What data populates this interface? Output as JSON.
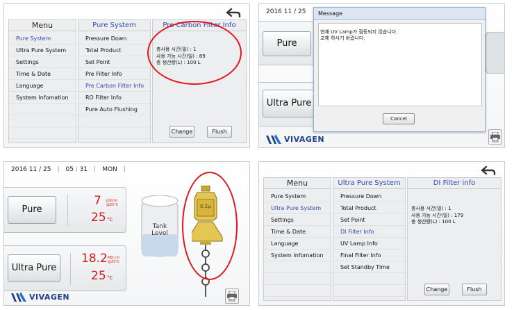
{
  "pure_settings": {
    "menu_header": "Menu",
    "menu_items": [
      "Pure System",
      "Ultra Pure System",
      "Settings",
      "Time & Date",
      "Language",
      "System Infomation"
    ],
    "sub_header": "Pure System",
    "sub_items": [
      "Pressure Down",
      "Total Product",
      "Set Point",
      "Pre Filter Info",
      "Pre Carbon Filter Info",
      "RO Filter Info",
      "Pure Auto Flushing"
    ],
    "info_header": "Pre Carbon Filter Info",
    "info_lines": [
      "총사용 시간(일) : 1",
      "사용 가능 시간(일) : 89",
      "총 생산량(L) : 100 L"
    ],
    "change_label": "Change",
    "flush_label": "Flush"
  },
  "message_screen": {
    "date": "2016 11 / 25",
    "dialog_title": "Message",
    "dialog_lines": [
      "현재 UV Lamp가 점등되지 않습니다.",
      "교체 하시기 바랍니다."
    ],
    "cancel_label": "Cancel",
    "pure_label": "Pure",
    "ultra_label": "Ultra Pure",
    "brand": "VIVAGEN",
    "print_label": "Print"
  },
  "home_screen": {
    "date": "2016 11 / 25",
    "time": "05 : 31",
    "day": "MON",
    "pure_label": "Pure",
    "pure_conductivity": "7",
    "pure_conductivity_unit": "μS/cm @25°C",
    "pure_temp": "25",
    "temp_unit": "°C",
    "ultra_label": "Ultra Pure",
    "ultra_resistivity": "18.2",
    "ultra_resistivity_unit": "MΩ.cm @25°C",
    "ultra_temp": "25",
    "tank_label_1": "Tank",
    "tank_label_2": "Level",
    "filter_label": "0.2μ",
    "brand": "VIVAGEN",
    "print_label": "Print"
  },
  "ultra_settings": {
    "menu_header": "Menu",
    "menu_items": [
      "Pure System",
      "Ultra Pure System",
      "Settings",
      "Time & Date",
      "Language",
      "System Infomation"
    ],
    "sub_header": "Ultra Pure System",
    "sub_items": [
      "Pressure Down",
      "Total Product",
      "Set Point",
      "DI Filter Info",
      "UV Lamp Info",
      "Final Filter Info",
      "Set Standby Time"
    ],
    "info_header": "DI Filter info",
    "info_lines": [
      "총사용 시간(일) : 1",
      "사용 가능 시간(일) : 179",
      "총 생산량(L) : 100 L"
    ],
    "change_label": "Change",
    "flush_label": "Flush"
  },
  "colors": {
    "accent_blue": "#3348b8",
    "reading_red": "#d41a1a",
    "annotation_red": "#e3141b"
  }
}
